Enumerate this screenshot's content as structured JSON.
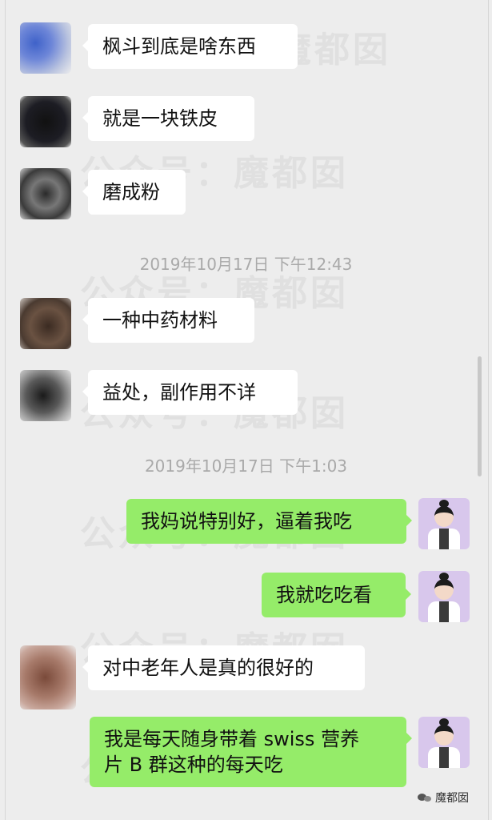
{
  "watermark": {
    "text_top": "魔都囡",
    "text_full": "公众号：魔都囡"
  },
  "messages": [
    {
      "text": "枫斗到底是啥东西"
    },
    {
      "text": "就是一块铁皮"
    },
    {
      "text": "磨成粉"
    },
    {
      "text": "一种中药材料"
    },
    {
      "text": "益处，副作用不详"
    },
    {
      "text": "我妈说特别好，逼着我吃"
    },
    {
      "text": "我就吃吃看"
    },
    {
      "text": "对中老年人是真的很好的"
    },
    {
      "text_line1": "我是每天随身带着 swiss 营养",
      "text_line2": "片 B 群这种的每天吃"
    }
  ],
  "timestamps": [
    {
      "text": "2019年10月17日 下午12:43"
    },
    {
      "text": "2019年10月17日 下午1:03"
    }
  ],
  "brand": {
    "label": "魔都囡"
  },
  "colors": {
    "background": "#ededed",
    "incoming_bubble": "#ffffff",
    "outgoing_bubble": "#95ec69",
    "timestamp_text": "#a9a9a9"
  }
}
